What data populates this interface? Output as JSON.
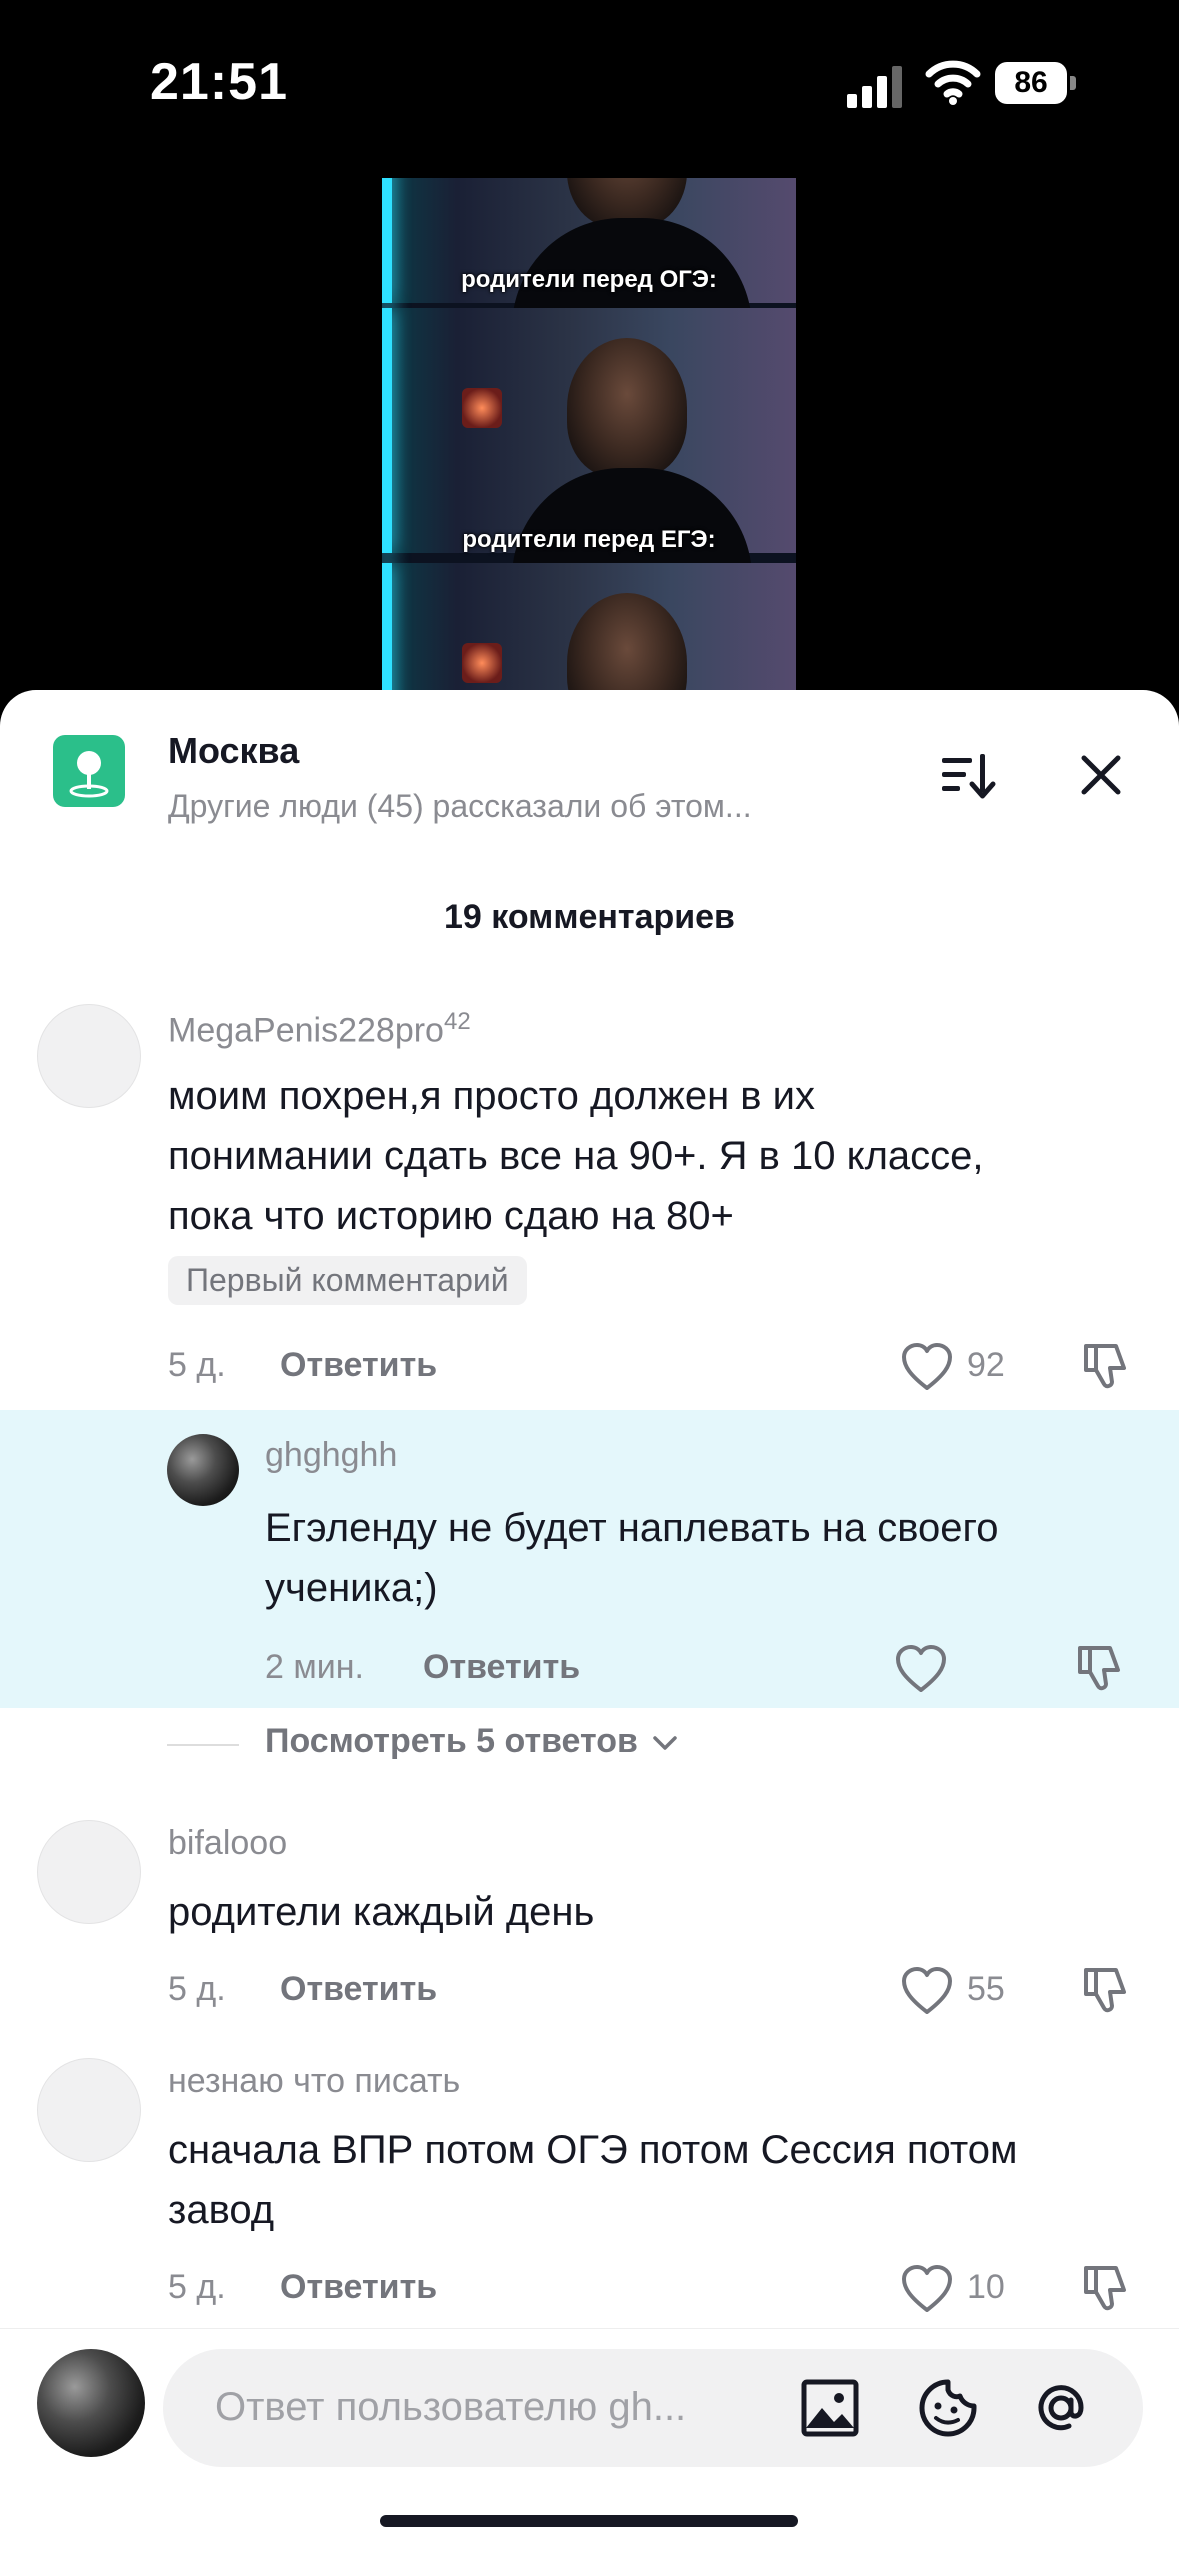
{
  "status_bar": {
    "time": "21:51",
    "battery": "86"
  },
  "video": {
    "captions": [
      "родители перед ОГЭ:",
      "родители перед ЕГЭ:"
    ]
  },
  "location": {
    "title": "Москва",
    "subtitle": "Другие люди (45) рассказали об этом..."
  },
  "comments_count": "19 комментариев",
  "comments": [
    {
      "username": "MegaPenis228pro",
      "username_sup": "42",
      "text_lines": [
        "моим похрен,я просто должен в их",
        "понимании сдать все на 90+. Я в 10 классе,",
        "пока что историю сдаю на 80+"
      ],
      "badge": "Первый комментарий",
      "time": "5 д.",
      "reply": "Ответить",
      "likes": "92"
    },
    {
      "username": "ghghghh",
      "text_lines": [
        "Егэленду не будет наплевать на своего",
        "ученика;)"
      ],
      "time": "2 мин.",
      "reply": "Ответить",
      "likes": ""
    },
    {
      "username": "bifalooo",
      "text_lines": [
        "родители каждый день"
      ],
      "time": "5 д.",
      "reply": "Ответить",
      "likes": "55"
    },
    {
      "username": "незнаю что писать",
      "text_lines": [
        "сначала ВПР потом ОГЭ потом Сессия потом",
        "завод"
      ],
      "time": "5 д.",
      "reply": "Ответить",
      "likes": "10"
    }
  ],
  "view_replies": "Посмотреть 5 ответов",
  "input": {
    "placeholder": "Ответ пользователю gh..."
  },
  "colors": {
    "highlight": "#e4f7fb",
    "location_icon": "#2bbf8a",
    "text": "#161823",
    "muted": "#8a8b91"
  }
}
